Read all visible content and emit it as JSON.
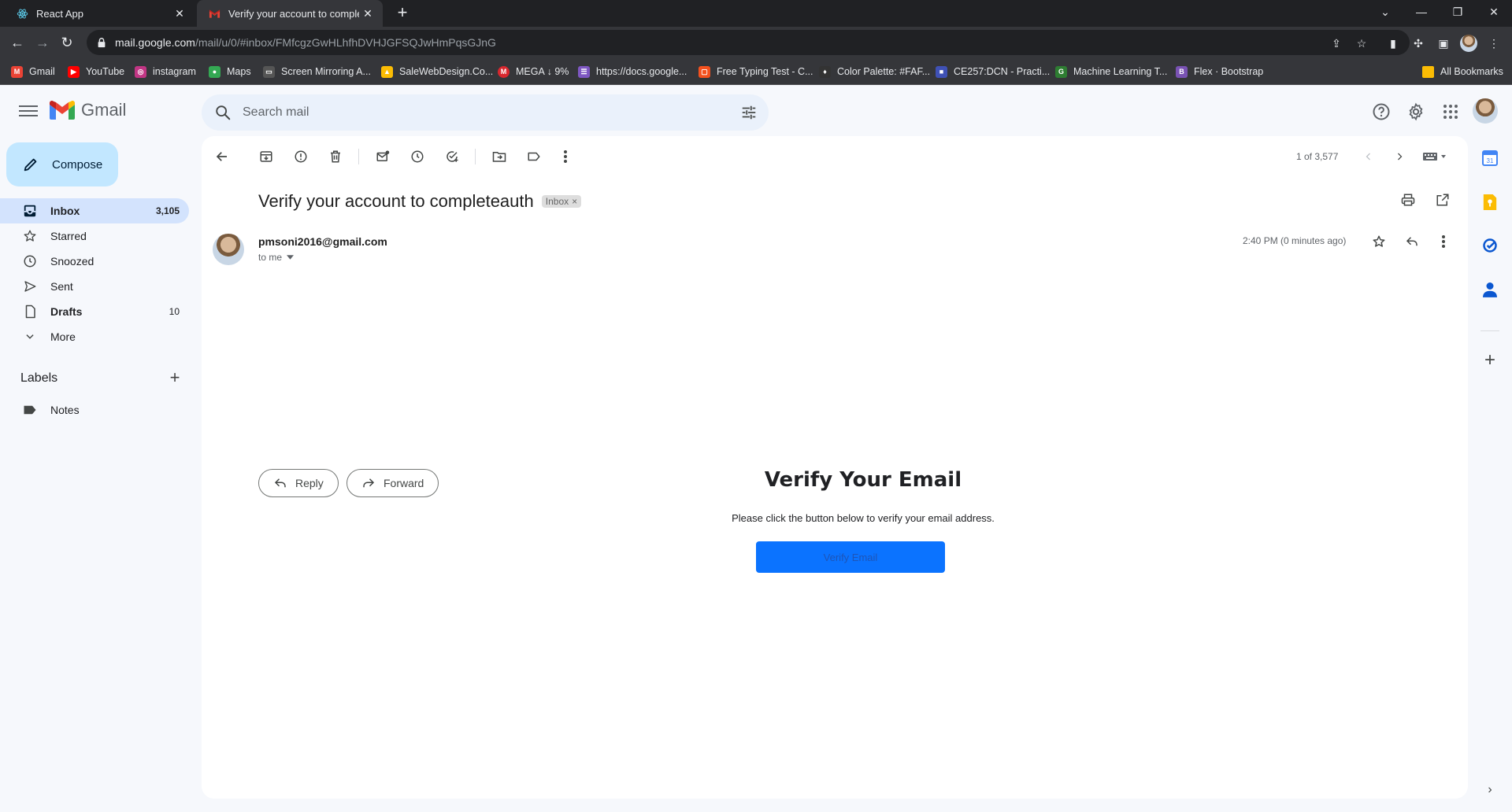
{
  "browser": {
    "tabs": [
      {
        "label": "React App",
        "favicon": "react-icon"
      },
      {
        "label": "Verify your account to completeauth",
        "favicon": "gmail-icon"
      }
    ],
    "url_host": "mail.google.com",
    "url_path": "/mail/u/0/#inbox/FMfcgzGwHLhfhDVHJGFSQJwHmPqsGJnG",
    "bookmarks": [
      {
        "label": "Gmail",
        "color": "#ea4335"
      },
      {
        "label": "YouTube",
        "color": "#ff0000"
      },
      {
        "label": "instagram",
        "color": "#c13584"
      },
      {
        "label": "Maps",
        "color": "#34a853"
      },
      {
        "label": "Screen Mirroring A...",
        "color": "#555555"
      },
      {
        "label": "SaleWebDesign.Co...",
        "color": "#fbbc04"
      },
      {
        "label": "MEGA ↓ 9%",
        "color": "#d9272e"
      },
      {
        "label": "https://docs.google...",
        "color": "#7e57c2"
      },
      {
        "label": "Free Typing Test - C...",
        "color": "#f4511e"
      },
      {
        "label": "Color Palette: #FAF...",
        "color": "#333333"
      },
      {
        "label": "CE257:DCN - Practi...",
        "color": "#3f51b5"
      },
      {
        "label": "Machine Learning T...",
        "color": "#2e7d32"
      },
      {
        "label": "Flex · Bootstrap",
        "color": "#7952b3"
      }
    ],
    "all_bookmarks": "All Bookmarks"
  },
  "gmail": {
    "logo_text": "Gmail",
    "search_placeholder": "Search mail"
  },
  "sidebar": {
    "compose": "Compose",
    "items": [
      {
        "label": "Inbox",
        "count": "3,105"
      },
      {
        "label": "Starred",
        "count": ""
      },
      {
        "label": "Snoozed",
        "count": ""
      },
      {
        "label": "Sent",
        "count": ""
      },
      {
        "label": "Drafts",
        "count": "10"
      },
      {
        "label": "More",
        "count": ""
      }
    ],
    "labels_title": "Labels",
    "labels": [
      {
        "label": "Notes"
      }
    ]
  },
  "email": {
    "pager": "1 of 3,577",
    "subject": "Verify your account to completeauth",
    "badge": "Inbox",
    "sender": "pmsoni2016@gmail.com",
    "to": "to me",
    "time": "2:40 PM (0 minutes ago)",
    "body": {
      "heading": "Verify Your Email",
      "text": "Please click the button below to verify your email address.",
      "button": "Verify Email",
      "button_color": "#0b73ff"
    },
    "reply": "Reply",
    "forward": "Forward"
  }
}
